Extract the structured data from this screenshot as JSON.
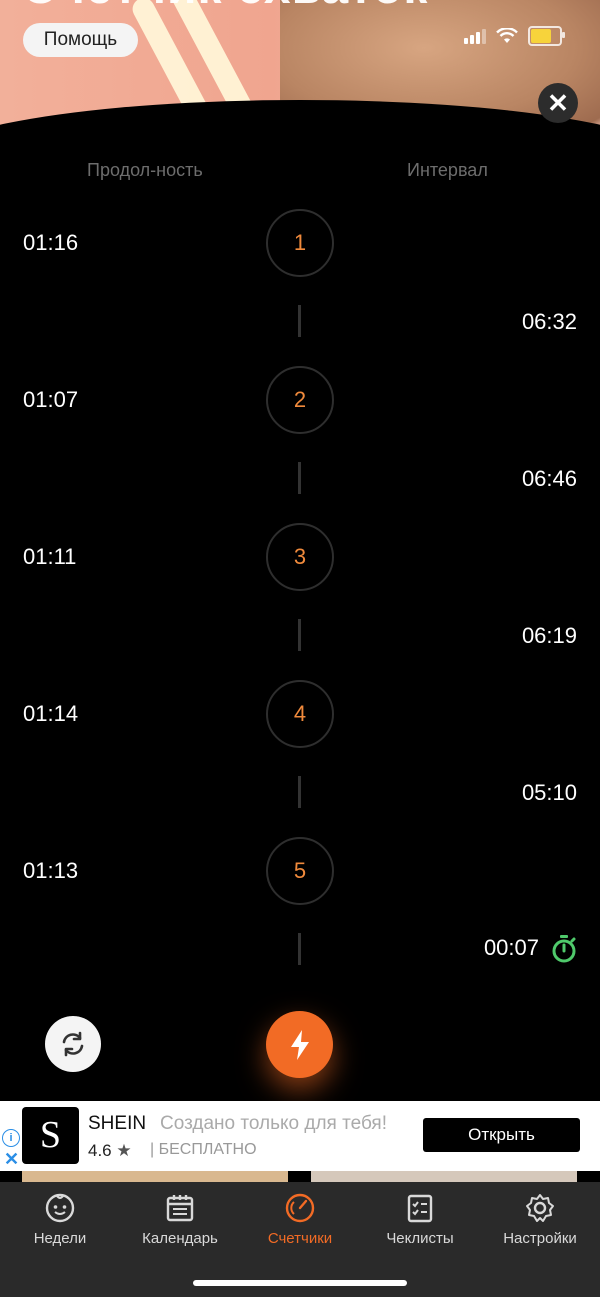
{
  "header": {
    "title_partial": "Счётчик схваток",
    "help_label": "Помощь",
    "close_label": "✕"
  },
  "columns": {
    "duration": "Продол-ность",
    "interval": "Интервал"
  },
  "contractions": [
    {
      "num": "1",
      "duration": "01:16"
    },
    {
      "num": "2",
      "duration": "01:07"
    },
    {
      "num": "3",
      "duration": "01:11"
    },
    {
      "num": "4",
      "duration": "01:14"
    },
    {
      "num": "5",
      "duration": "01:13"
    }
  ],
  "intervals": [
    "06:32",
    "06:46",
    "06:19",
    "05:10",
    "00:07"
  ],
  "colors": {
    "accent": "#f26b25",
    "number": "#f08a3c",
    "timer_green": "#4fc96b"
  },
  "ad": {
    "brand": "SHEIN",
    "promo": "Создано только для тебя!",
    "rating": "4.6",
    "star": "★",
    "price": "| БЕСПЛАТНО",
    "cta": "Открыть"
  },
  "tabs": [
    {
      "label": "Недели",
      "icon": "baby-face-icon"
    },
    {
      "label": "Календарь",
      "icon": "calendar-icon"
    },
    {
      "label": "Счетчики",
      "icon": "timer-icon",
      "active": true
    },
    {
      "label": "Чеклисты",
      "icon": "checklist-icon"
    },
    {
      "label": "Настройки",
      "icon": "gear-icon"
    }
  ]
}
